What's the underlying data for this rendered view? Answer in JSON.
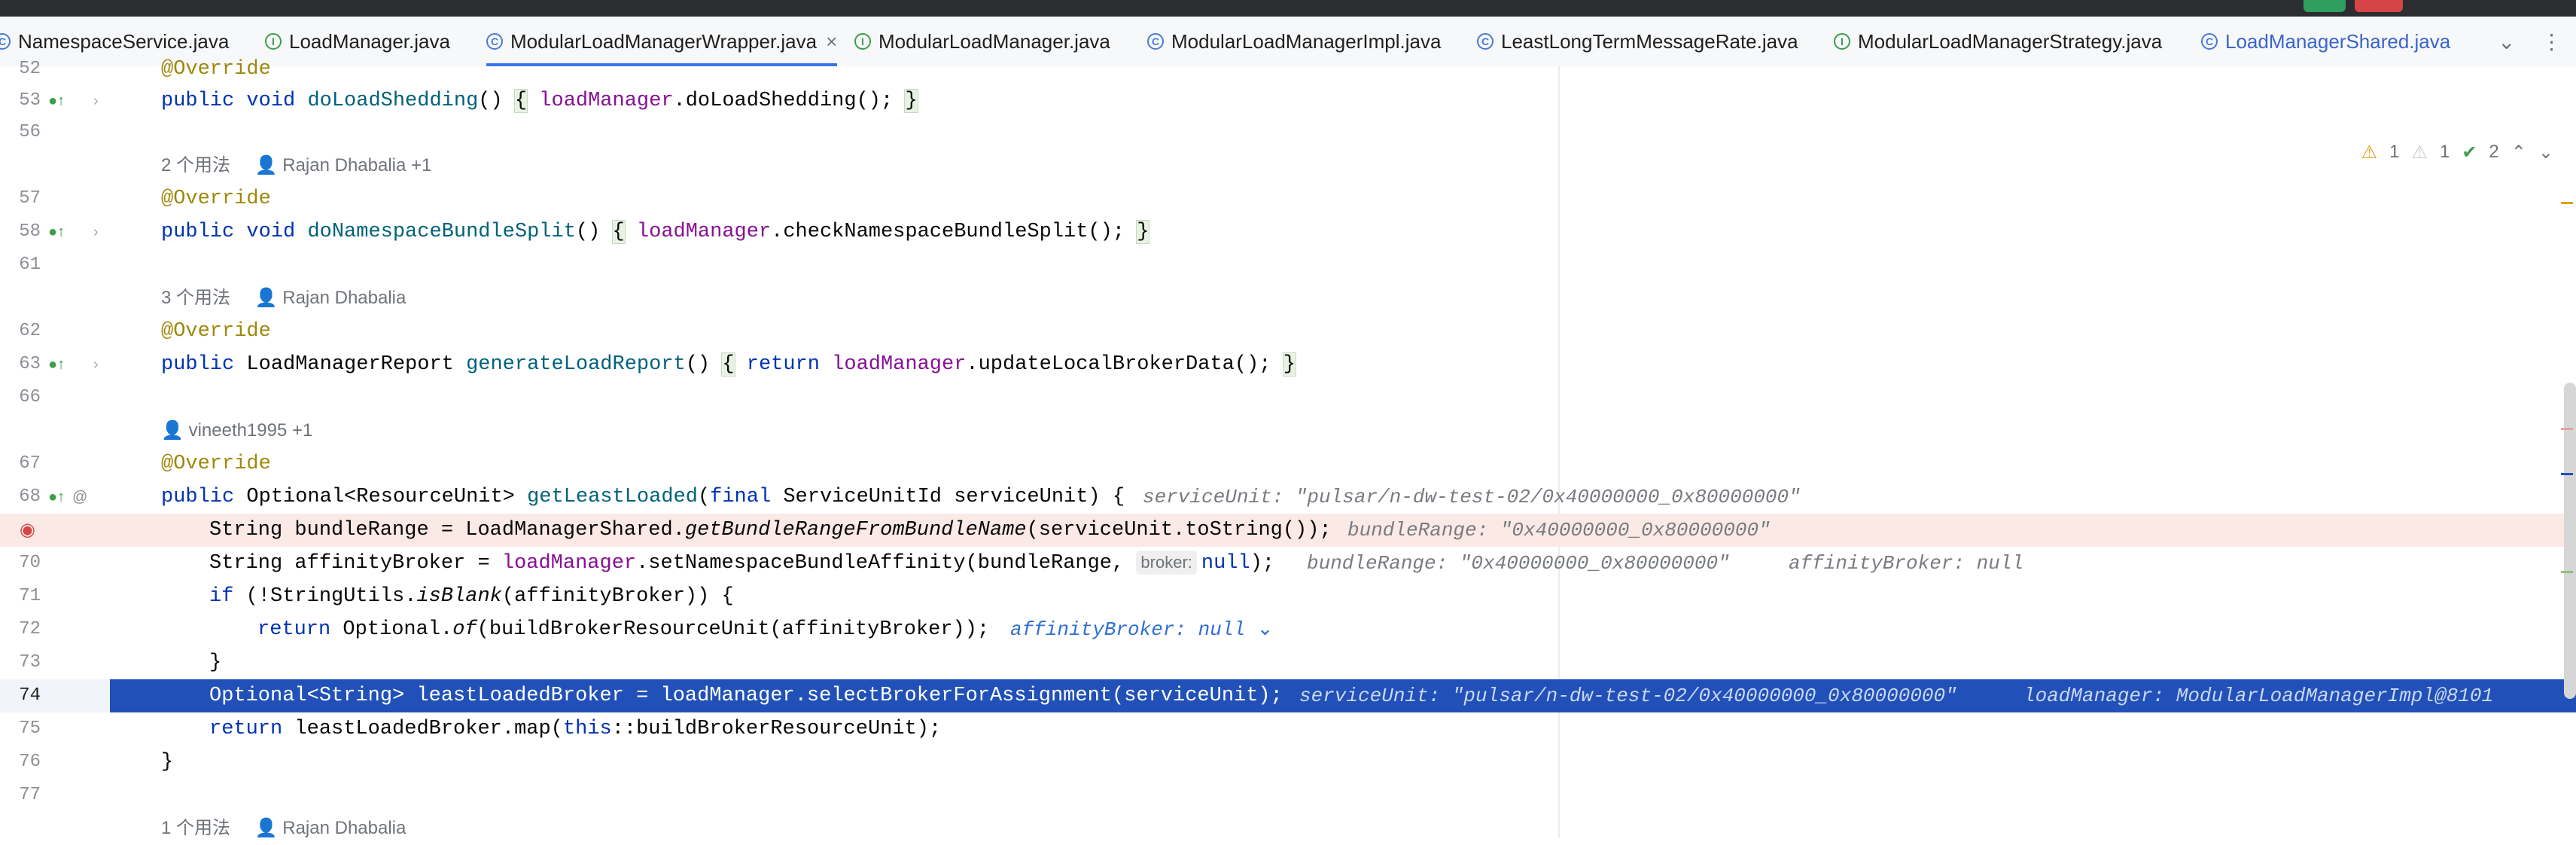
{
  "tabs": [
    {
      "label": "NamespaceService.java",
      "icon": "class-icon"
    },
    {
      "label": "LoadManager.java",
      "icon": "interface-icon"
    },
    {
      "label": "ModularLoadManagerWrapper.java",
      "icon": "class-icon",
      "active": true
    },
    {
      "label": "ModularLoadManager.java",
      "icon": "interface-icon"
    },
    {
      "label": "ModularLoadManagerImpl.java",
      "icon": "class-icon"
    },
    {
      "label": "LeastLongTermMessageRate.java",
      "icon": "class-icon"
    },
    {
      "label": "ModularLoadManagerStrategy.java",
      "icon": "interface-icon"
    },
    {
      "label": "LoadManagerShared.java",
      "icon": "class-icon"
    }
  ],
  "inspection": {
    "warnings_a": "1",
    "warnings_b": "1",
    "ok": "2"
  },
  "lines": {
    "l52": "52",
    "l53": "53",
    "l56": "56",
    "meta1": {
      "usages": "2 个用法",
      "author": "Rajan Dhabalia +1"
    },
    "l57": "57",
    "l58": "58",
    "l61": "61",
    "meta2": {
      "usages": "3 个用法",
      "author": "Rajan Dhabalia"
    },
    "l62": "62",
    "l63": "63",
    "l66": "66",
    "meta3": {
      "author": "vineeth1995 +1"
    },
    "l67": "67",
    "l68": "68",
    "l70": "70",
    "l71": "71",
    "l72": "72",
    "l73": "73",
    "l74": "74",
    "l75": "75",
    "l76": "76",
    "l77": "77",
    "meta4": {
      "usages": "1 个用法",
      "author": "Rajan Dhabalia"
    }
  },
  "hints": {
    "h68": "serviceUnit: \"pulsar/n-dw-test-02/0x40000000_0x80000000\"",
    "h69": "bundleRange: \"0x40000000_0x80000000\"",
    "h70_param": "broker:",
    "h70a": "bundleRange: \"0x40000000_0x80000000\"",
    "h70b": "affinityBroker: null",
    "h72": "affinityBroker: null",
    "h74a": "serviceUnit: \"pulsar/n-dw-test-02/0x40000000_0x80000000\"",
    "h74b": "loadManager: ModularLoadManagerImpl@8101"
  }
}
